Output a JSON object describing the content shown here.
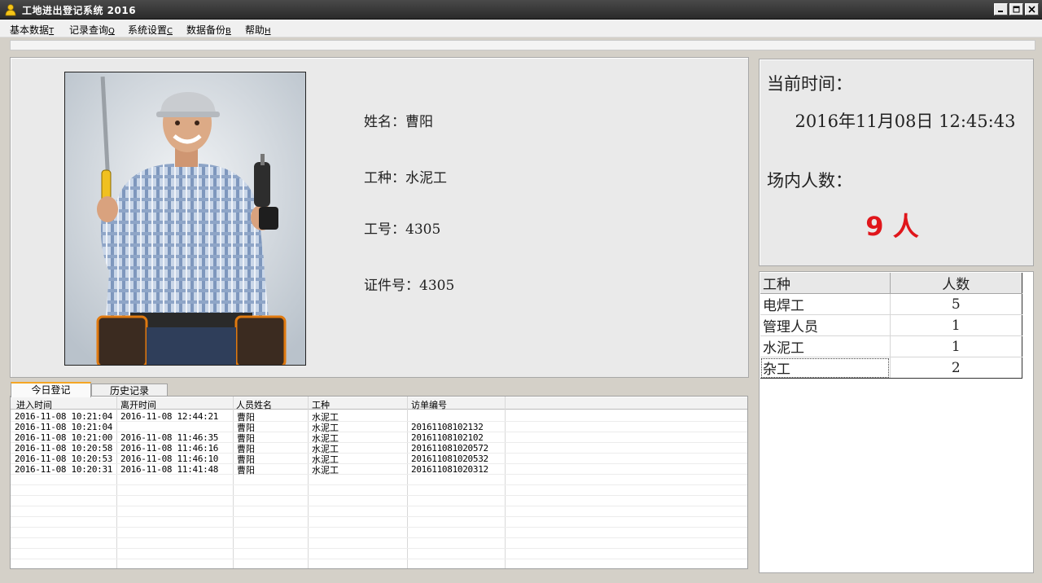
{
  "window": {
    "title": "工地进出登记系统 2016",
    "title_icon": "user-icon",
    "buttons": [
      "minimize-icon",
      "maximize-icon",
      "close-icon"
    ]
  },
  "menu": {
    "items": [
      {
        "label": "基本数据",
        "key": "T"
      },
      {
        "label": "记录查询",
        "key": "Q"
      },
      {
        "label": "系统设置",
        "key": "C"
      },
      {
        "label": "数据备份",
        "key": "B"
      },
      {
        "label": "帮助",
        "key": "H"
      }
    ]
  },
  "person": {
    "name_label": "姓名：",
    "name": "曹阳",
    "type_label": "工种：",
    "type": "水泥工",
    "id_label": "工号：",
    "id": "4305",
    "cert_label": "证件号：",
    "cert": "4305"
  },
  "status": {
    "time_label": "当前时间：",
    "time_value": "2016年11月08日  12:45:43",
    "count_label": "场内人数：",
    "count_value": "9 人"
  },
  "work_summary": {
    "headers": [
      "工种",
      "人数"
    ],
    "rows": [
      {
        "type": "电焊工",
        "count": "5"
      },
      {
        "type": "管理人员",
        "count": "1"
      },
      {
        "type": "水泥工",
        "count": "1"
      },
      {
        "type": "杂工",
        "count": "2"
      }
    ]
  },
  "tabs": [
    "今日登记",
    "历史记录"
  ],
  "records": {
    "headers": [
      "进入时间",
      "离开时间",
      "人员姓名",
      "工种",
      "访单编号"
    ],
    "rows": [
      [
        "2016-11-08 10:21:04",
        "2016-11-08 12:44:21",
        "曹阳",
        "水泥工",
        ""
      ],
      [
        "2016-11-08 10:21:04",
        "",
        "曹阳",
        "水泥工",
        "20161108102132"
      ],
      [
        "2016-11-08 10:21:00",
        "2016-11-08 11:46:35",
        "曹阳",
        "水泥工",
        "20161108102102"
      ],
      [
        "2016-11-08 10:20:58",
        "2016-11-08 11:46:16",
        "曹阳",
        "水泥工",
        "201611081020572"
      ],
      [
        "2016-11-08 10:20:53",
        "2016-11-08 11:46:10",
        "曹阳",
        "水泥工",
        "201611081020532"
      ],
      [
        "2016-11-08 10:20:31",
        "2016-11-08 11:41:48",
        "曹阳",
        "水泥工",
        "201611081020312"
      ]
    ]
  },
  "colors": {
    "accent": "#e0161b",
    "tab_highlight": "#f5a623"
  }
}
